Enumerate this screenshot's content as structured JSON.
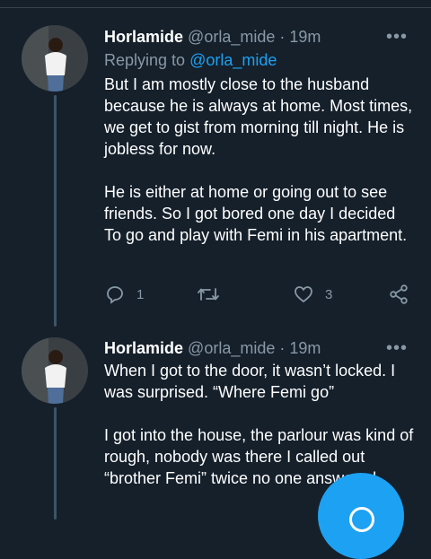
{
  "tweets": [
    {
      "name": "Horlamide",
      "handle": "@orla_mide",
      "separator": "·",
      "time": "19m",
      "more_icon": "more-dots-icon",
      "replying_prefix": "Replying to",
      "replying_to": "@orla_mide",
      "paragraphs": [
        "But I am mostly close to the husband because he is always at home. Most times, we get to gist from morning till night. He is jobless for now.",
        "He is either at home or going out to see friends. So I got bored one day I decided To go and play with Femi in his apartment."
      ],
      "reply_count": "1",
      "like_count": "3"
    },
    {
      "name": "Horlamide",
      "handle": "@orla_mide",
      "separator": "·",
      "time": "19m",
      "more_icon": "more-dots-icon",
      "paragraphs": [
        "When I got to the door, it wasn’t locked. I was surprised. “Where Femi go”",
        "I got into the house, the parlour was kind of rough, nobody was there I called out “brother Femi” twice no one answered"
      ]
    }
  ],
  "icons": {
    "reply": "reply-icon",
    "retweet": "retweet-icon",
    "like": "heart-icon",
    "share": "share-icon",
    "compose": "compose-icon"
  },
  "colors": {
    "background": "#15202b",
    "muted": "#8899a6",
    "link": "#1da1f2",
    "fab": "#1da1f2"
  }
}
